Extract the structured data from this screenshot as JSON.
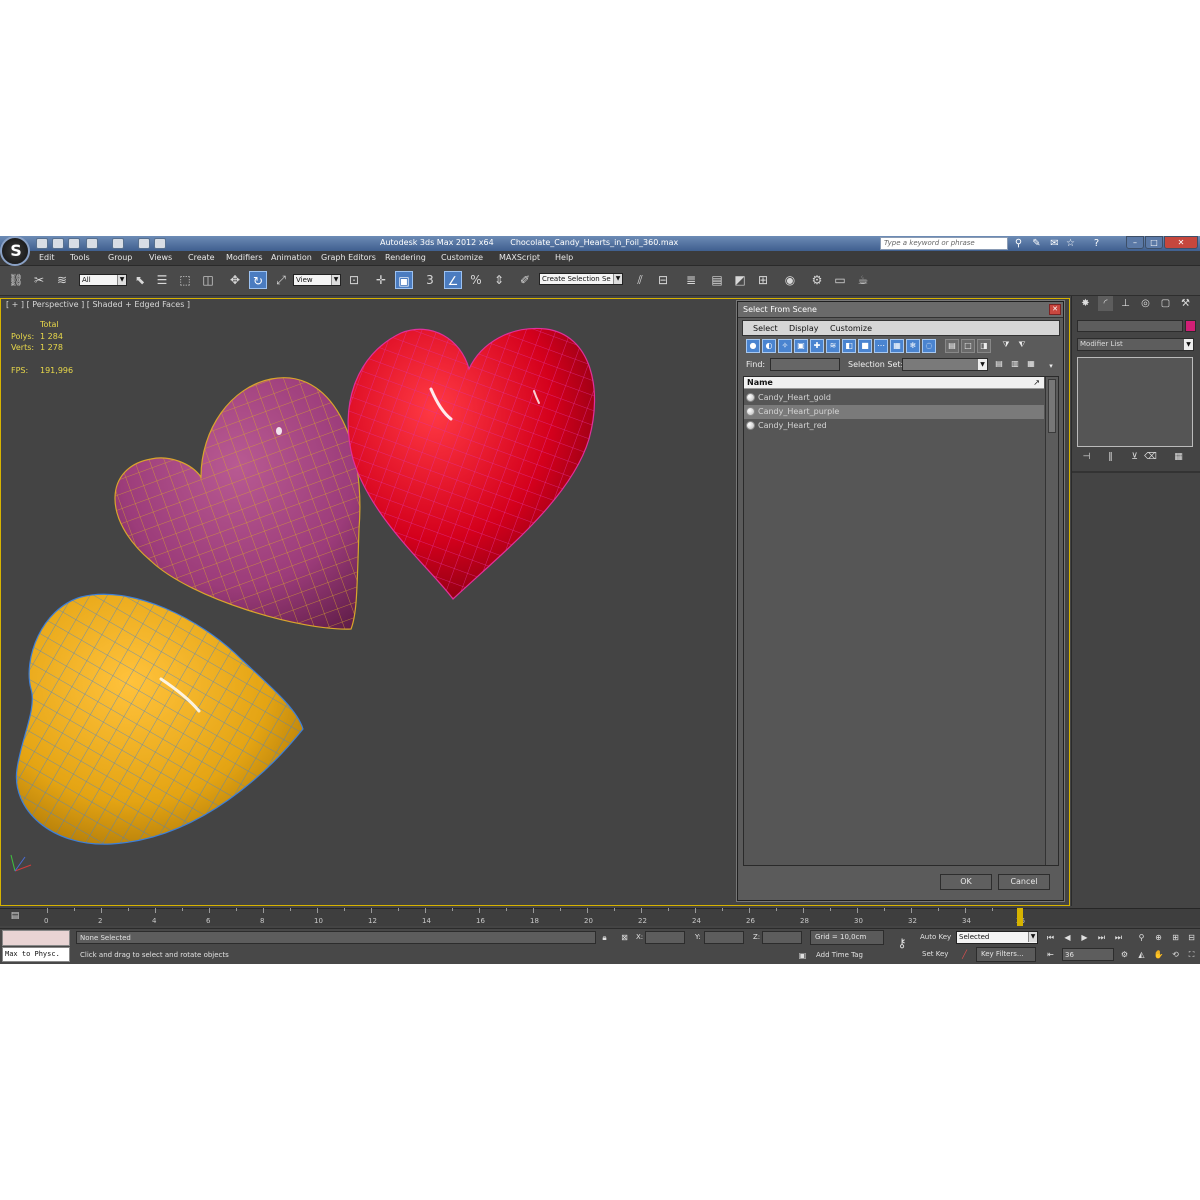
{
  "window": {
    "app_title": "Autodesk 3ds Max  2012 x64",
    "file_title": "Chocolate_Candy_Hearts_in_Foil_360.max",
    "search_placeholder": "Type a keyword or phrase",
    "app_logo_letter": "S"
  },
  "menu": [
    "Edit",
    "Tools",
    "Group",
    "Views",
    "Create",
    "Modifiers",
    "Animation",
    "Graph Editors",
    "Rendering",
    "Customize",
    "MAXScript",
    "Help"
  ],
  "toolbar": {
    "filter_value": "All",
    "ref_coord_value": "View",
    "snap_label": "3",
    "create_selection_set": "Create Selection Se"
  },
  "viewport": {
    "label": "[ + ] [ Perspective ] [ Shaded + Edged Faces ]",
    "stats": {
      "total_label": "Total",
      "polys_label": "Polys:",
      "polys_value": "1 284",
      "verts_label": "Verts:",
      "verts_value": "1 278",
      "fps_label": "FPS:",
      "fps_value": "191,996"
    },
    "object_colors": {
      "gold": "#e4a413",
      "purple": "#9c3c7a",
      "red": "#d4001c",
      "gold_wire": "#3d7fd9",
      "purple_wire": "#d9a52c",
      "red_wire": "#e0309b"
    }
  },
  "dialog": {
    "title": "Select From Scene",
    "menu": [
      "Select",
      "Display",
      "Customize"
    ],
    "find_label": "Find:",
    "selection_set_label": "Selection Set:",
    "column_name": "Name",
    "items": [
      {
        "name": "Candy_Heart_gold",
        "selected": false
      },
      {
        "name": "Candy_Heart_purple",
        "selected": true
      },
      {
        "name": "Candy_Heart_red",
        "selected": false
      }
    ],
    "ok_label": "OK",
    "cancel_label": "Cancel"
  },
  "command_panel": {
    "modifier_list_label": "Modifier List",
    "object_color": "#d11f76"
  },
  "timeline": {
    "ticks": [
      "0",
      "2",
      "4",
      "6",
      "8",
      "10",
      "12",
      "14",
      "16",
      "18",
      "20",
      "22",
      "24",
      "26",
      "28",
      "30",
      "32",
      "34",
      "36"
    ]
  },
  "status": {
    "listener_text": "Max to Physc.",
    "selection_text": "None Selected",
    "prompt_text": "Click and drag to select and rotate objects",
    "x_label": "X:",
    "y_label": "Y:",
    "z_label": "Z:",
    "grid_text": "Grid = 10,0cm",
    "add_time_tag": "Add Time Tag",
    "auto_key": "Auto Key",
    "selected_value": "Selected",
    "set_key": "Set Key",
    "key_filters": "Key Filters...",
    "current_frame": "36"
  }
}
